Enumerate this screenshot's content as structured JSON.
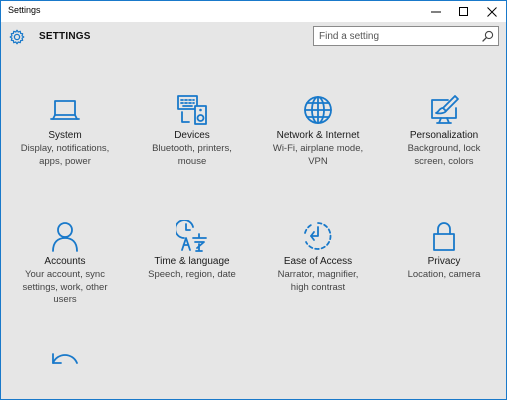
{
  "window": {
    "title": "Settings",
    "controls": [
      "minimize",
      "maximize",
      "close"
    ]
  },
  "header": {
    "icon": "gear-icon",
    "title": "SETTINGS"
  },
  "search": {
    "placeholder": "Find a setting",
    "icon": "search-icon"
  },
  "colors": {
    "accent": "#1979ca",
    "background": "#e6e6e6"
  },
  "categories": [
    {
      "label": "System",
      "desc_lines": [
        "Display, notifications,",
        "apps, power"
      ],
      "icon": "laptop-icon"
    },
    {
      "label": "Devices",
      "desc_lines": [
        "Bluetooth, printers,",
        "mouse"
      ],
      "icon": "devices-icon"
    },
    {
      "label": "Network & Internet",
      "desc_lines": [
        "Wi-Fi, airplane mode,",
        "VPN"
      ],
      "icon": "globe-icon"
    },
    {
      "label": "Personalization",
      "desc_lines": [
        "Background, lock",
        "screen, colors"
      ],
      "icon": "paint-icon"
    },
    {
      "label": "Accounts",
      "desc_lines": [
        "Your account, sync",
        "settings, work, other",
        "users"
      ],
      "icon": "person-icon"
    },
    {
      "label": "Time & language",
      "desc_lines": [
        "Speech, region, date"
      ],
      "icon": "time-language-icon"
    },
    {
      "label": "Ease of Access",
      "desc_lines": [
        "Narrator, magnifier,",
        "high contrast"
      ],
      "icon": "ease-of-access-icon"
    },
    {
      "label": "Privacy",
      "desc_lines": [
        "Location, camera"
      ],
      "icon": "lock-icon"
    },
    {
      "label": "",
      "desc_lines": [],
      "icon": "update-icon"
    }
  ]
}
